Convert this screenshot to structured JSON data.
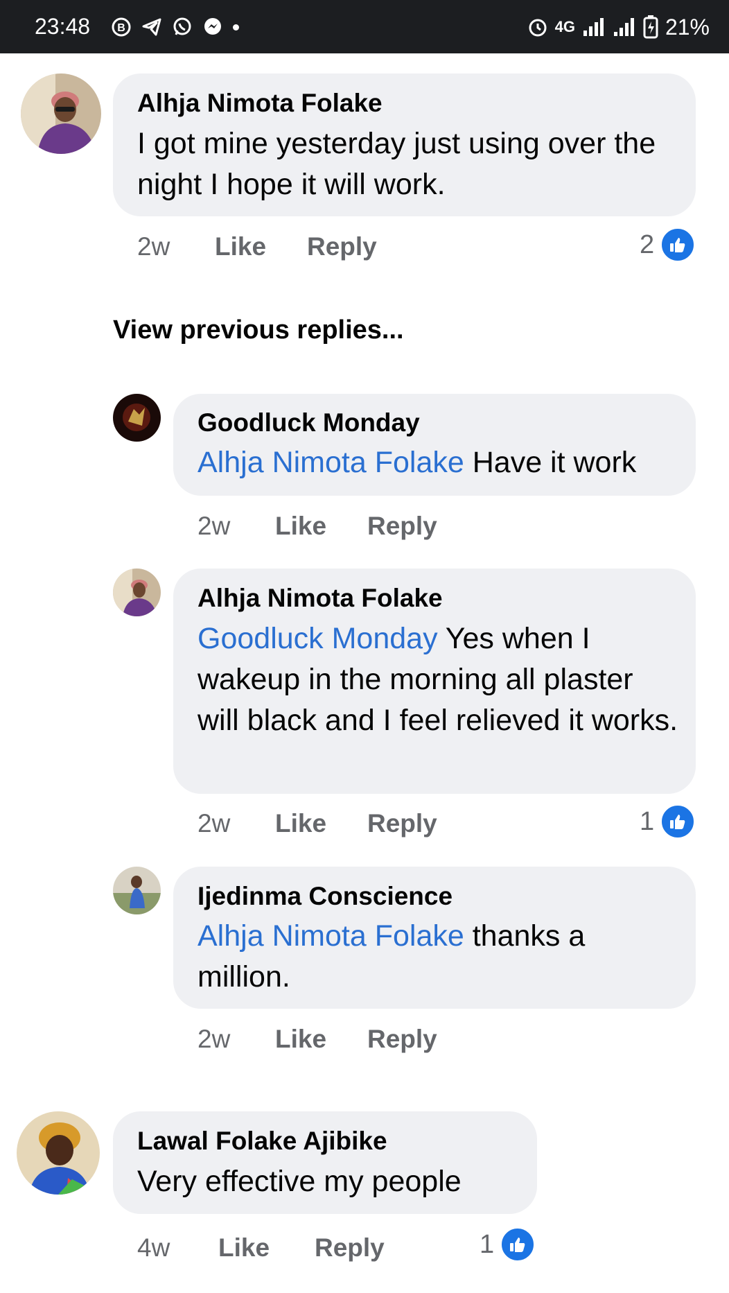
{
  "status_bar": {
    "time": "23:48",
    "network": "4G",
    "battery": "21%",
    "icons": [
      "b-icon",
      "telegram-icon",
      "whatsapp-icon",
      "messenger-icon",
      "alarm-icon",
      "signal-icon",
      "battery-charging-icon"
    ]
  },
  "comments": [
    {
      "author": "Alhja Nimota Folake",
      "text": "I got mine yesterday just using over the night I hope it will work.",
      "time": "2w",
      "like_label": "Like",
      "reply_label": "Reply",
      "reactions": "2"
    }
  ],
  "view_previous_label": "View previous replies...",
  "replies": [
    {
      "author": "Goodluck Monday",
      "mention": "Alhja Nimota Folake",
      "text": " Have it work",
      "time": "2w",
      "like_label": "Like",
      "reply_label": "Reply"
    },
    {
      "author": "Alhja Nimota Folake",
      "mention": "Goodluck Monday",
      "text": " Yes when I wakeup in the morning all plaster will black and I feel relieved it works.",
      "time": "2w",
      "like_label": "Like",
      "reply_label": "Reply",
      "reactions": "1"
    },
    {
      "author": "Ijedinma Conscience",
      "mention": "Alhja Nimota Folake",
      "text": " thanks a million.",
      "time": "2w",
      "like_label": "Like",
      "reply_label": "Reply"
    }
  ],
  "last_comment": {
    "author": "Lawal Folake Ajibike",
    "text": "Very effective my people",
    "time": "4w",
    "like_label": "Like",
    "reply_label": "Reply",
    "reactions": "1"
  },
  "colors": {
    "bubble": "#eff0f3",
    "mention": "#2a6fd1",
    "meta": "#65676b",
    "like_blue": "#1b74e4",
    "status_bar": "#1c1e21"
  }
}
